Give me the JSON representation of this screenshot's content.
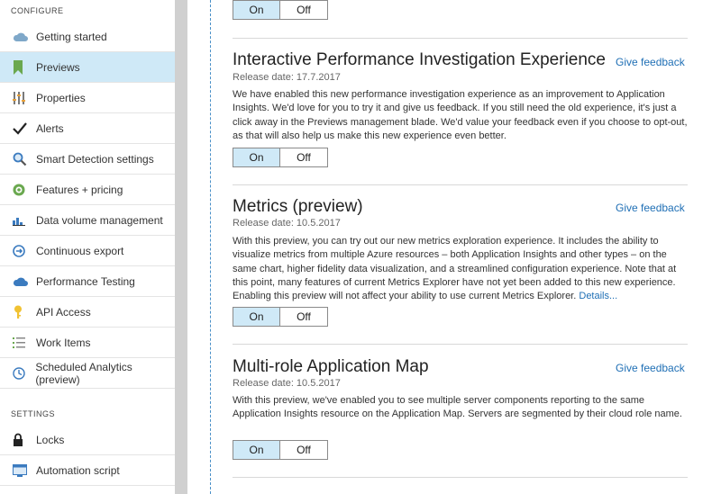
{
  "sidebar": {
    "configure_header": "CONFIGURE",
    "settings_header": "SETTINGS",
    "configure_items": [
      {
        "label": "Getting started",
        "icon": "cloud-icon"
      },
      {
        "label": "Previews",
        "icon": "bookmark-icon",
        "active": true
      },
      {
        "label": "Properties",
        "icon": "properties-bars-icon"
      },
      {
        "label": "Alerts",
        "icon": "checkmark-icon"
      },
      {
        "label": "Smart Detection settings",
        "icon": "magnifier-icon"
      },
      {
        "label": "Features + pricing",
        "icon": "target-icon"
      },
      {
        "label": "Data volume management",
        "icon": "bar-chart-icon"
      },
      {
        "label": "Continuous export",
        "icon": "export-icon"
      },
      {
        "label": "Performance Testing",
        "icon": "cloud-test-icon"
      },
      {
        "label": "API Access",
        "icon": "key-icon"
      },
      {
        "label": "Work Items",
        "icon": "list-icon"
      },
      {
        "label": "Scheduled Analytics (preview)",
        "icon": "clock-icon"
      }
    ],
    "settings_items": [
      {
        "label": "Locks",
        "icon": "lock-icon"
      },
      {
        "label": "Automation script",
        "icon": "script-icon"
      }
    ]
  },
  "top_toggle": {
    "on": "On",
    "off": "Off"
  },
  "previews": [
    {
      "title": "Interactive Performance Investigation Experience",
      "feedback": "Give feedback",
      "release_date": "Release date: 17.7.2017",
      "description": "We have enabled this new performance investigation experience as an improvement to Application Insights. We'd love for you to try it and give us feedback. If you still need the old experience, it's just a click away in the Previews management blade. We'd value your feedback even if you choose to opt-out, as that will also help us make this new experience even better.",
      "details_link": "",
      "toggle": {
        "on": "On",
        "off": "Off",
        "selected": "On"
      }
    },
    {
      "title": "Metrics (preview)",
      "feedback": "Give feedback",
      "release_date": "Release date: 10.5.2017",
      "description": "With this preview, you can try out our new metrics exploration experience. It includes the ability to visualize metrics from multiple Azure resources – both Application Insights and other types – on the same chart, higher fidelity data visualization, and a streamlined configuration experience. Note that at this point, many features of current Metrics Explorer have not yet been added to this new experience. Enabling this preview will not affect your ability to use current Metrics Explorer.",
      "details_link": "Details...",
      "toggle": {
        "on": "On",
        "off": "Off",
        "selected": "On"
      }
    },
    {
      "title": "Multi-role Application Map",
      "feedback": "Give feedback",
      "release_date": "Release date: 10.5.2017",
      "description": "With this preview, we've enabled you to see multiple server components reporting to the same Application Insights resource on the Application Map. Servers are segmented by their cloud role name.",
      "details_link": "",
      "toggle": {
        "on": "On",
        "off": "Off",
        "selected": "On"
      }
    }
  ]
}
